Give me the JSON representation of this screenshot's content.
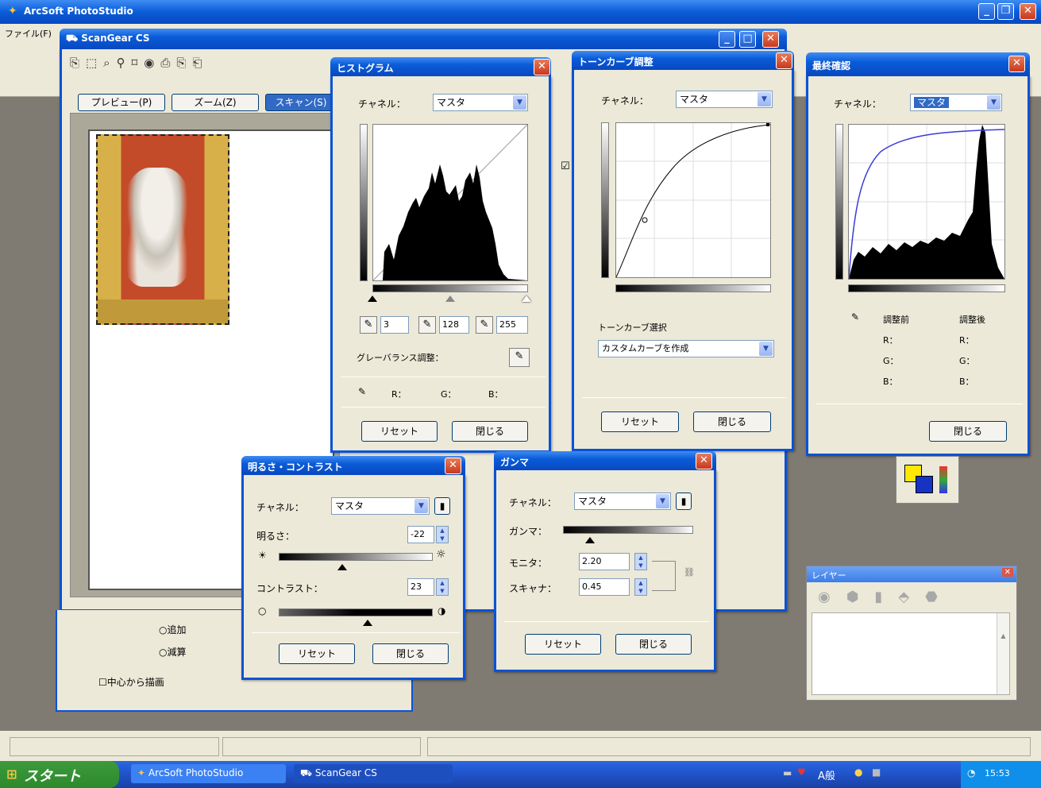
{
  "main_app": {
    "title": "ArcSoft PhotoStudio",
    "menu_file": "ファイル(F)"
  },
  "scangear": {
    "title": "ScanGear CS",
    "tabs": [
      "プレビュー(P)",
      "ズーム(Z)",
      "スキャン(S)"
    ],
    "radio_add": "追加",
    "radio_sub": "減算",
    "check_center": "中心から描画"
  },
  "histogram": {
    "title": "ヒストグラム",
    "channel_label": "チャネル：",
    "channel_value": "マスタ",
    "shadow_value": "3",
    "mid_value": "128",
    "highlight_value": "255",
    "gray_balance_label": "グレーバランス調整：",
    "r_label": "R：",
    "g_label": "G：",
    "b_label": "B：",
    "reset": "リセット",
    "close": "閉じる"
  },
  "tone_curve": {
    "title": "トーンカーブ調整",
    "channel_label": "チャネル：",
    "channel_value": "マスタ",
    "select_label": "トーンカーブ選択",
    "select_value": "カスタムカーブを作成",
    "reset": "リセット",
    "close": "閉じる"
  },
  "final_check": {
    "title": "最終確認",
    "channel_label": "チャネル：",
    "channel_value": "マスタ",
    "before_label": "調整前",
    "after_label": "調整後",
    "r_label": "R：",
    "g_label": "G：",
    "b_label": "B：",
    "close": "閉じる"
  },
  "brightness_contrast": {
    "title": "明るさ・コントラスト",
    "channel_label": "チャネル：",
    "channel_value": "マスタ",
    "brightness_label": "明るさ：",
    "brightness_value": "-22",
    "contrast_label": "コントラスト：",
    "contrast_value": "23",
    "reset": "リセット",
    "close": "閉じる"
  },
  "gamma": {
    "title": "ガンマ",
    "channel_label": "チャネル：",
    "channel_value": "マスタ",
    "gamma_label": "ガンマ：",
    "monitor_label": "モニタ：",
    "monitor_value": "2.20",
    "scanner_label": "スキャナ：",
    "scanner_value": "0.45",
    "reset": "リセット",
    "close": "閉じる"
  },
  "layers": {
    "title": "レイヤー"
  },
  "taskbar": {
    "start": "スタート",
    "item1": "ArcSoft PhotoStudio",
    "item2": "ScanGear CS",
    "ime": "A般",
    "clock": "15:53"
  }
}
